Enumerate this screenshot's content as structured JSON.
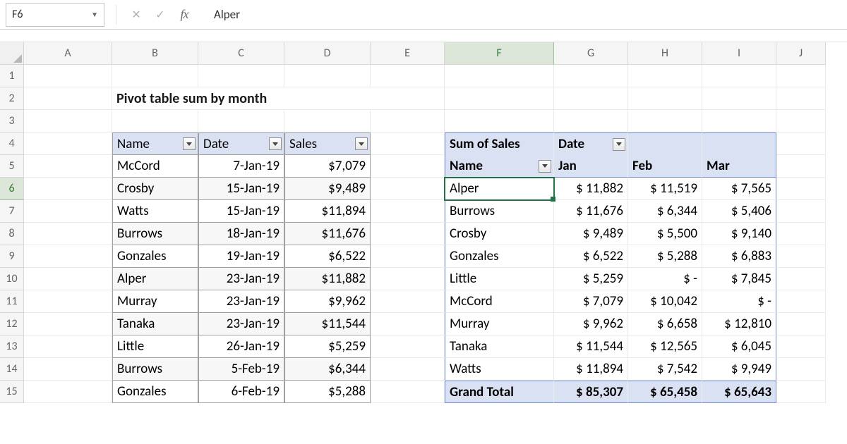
{
  "formula_bar": {
    "cell_ref": "F6",
    "value_display": "Alper"
  },
  "columns": [
    "A",
    "B",
    "C",
    "D",
    "E",
    "F",
    "G",
    "H",
    "I",
    "J"
  ],
  "row_numbers": [
    1,
    2,
    3,
    4,
    5,
    6,
    7,
    8,
    9,
    10,
    11,
    12,
    13,
    14,
    15
  ],
  "title": "Pivot table sum by month",
  "active_cell_row": 6,
  "active_cell_col": "F",
  "src_table": {
    "headers": [
      "Name",
      "Date",
      "Sales"
    ],
    "rows": [
      {
        "name": "McCord",
        "date": "7-Jan-19",
        "sales": "$7,079"
      },
      {
        "name": "Crosby",
        "date": "15-Jan-19",
        "sales": "$9,489"
      },
      {
        "name": "Watts",
        "date": "15-Jan-19",
        "sales": "$11,894"
      },
      {
        "name": "Burrows",
        "date": "18-Jan-19",
        "sales": "$11,676"
      },
      {
        "name": "Gonzales",
        "date": "19-Jan-19",
        "sales": "$6,522"
      },
      {
        "name": "Alper",
        "date": "23-Jan-19",
        "sales": "$11,882"
      },
      {
        "name": "Murray",
        "date": "23-Jan-19",
        "sales": "$9,962"
      },
      {
        "name": "Tanaka",
        "date": "23-Jan-19",
        "sales": "$11,544"
      },
      {
        "name": "Little",
        "date": "26-Jan-19",
        "sales": "$5,259"
      },
      {
        "name": "Burrows",
        "date": "5-Feb-19",
        "sales": "$6,344"
      },
      {
        "name": "Gonzales",
        "date": "6-Feb-19",
        "sales": "$5,288"
      }
    ]
  },
  "pivot": {
    "corner_label": "Sum of Sales",
    "col_field": "Date",
    "row_field": "Name",
    "col_headers": [
      "Jan",
      "Feb",
      "Mar"
    ],
    "rows": [
      {
        "name": "Alper",
        "vals": [
          "$ 11,882",
          "$ 11,519",
          "$  7,565"
        ]
      },
      {
        "name": "Burrows",
        "vals": [
          "$ 11,676",
          "$  6,344",
          "$  5,406"
        ]
      },
      {
        "name": "Crosby",
        "vals": [
          "$  9,489",
          "$  5,500",
          "$  9,140"
        ]
      },
      {
        "name": "Gonzales",
        "vals": [
          "$  6,522",
          "$  5,288",
          "$  6,883"
        ]
      },
      {
        "name": "Little",
        "vals": [
          "$  5,259",
          "$        -",
          "$  7,845"
        ]
      },
      {
        "name": "McCord",
        "vals": [
          "$  7,079",
          "$ 10,042",
          "$        -"
        ]
      },
      {
        "name": "Murray",
        "vals": [
          "$  9,962",
          "$  6,658",
          "$ 12,810"
        ]
      },
      {
        "name": "Tanaka",
        "vals": [
          "$ 11,544",
          "$ 12,565",
          "$  6,045"
        ]
      },
      {
        "name": "Watts",
        "vals": [
          "$ 11,894",
          "$  7,542",
          "$  9,949"
        ]
      }
    ],
    "total_label": "Grand Total",
    "totals": [
      "$ 85,307",
      "$ 65,458",
      "$ 65,643"
    ]
  }
}
